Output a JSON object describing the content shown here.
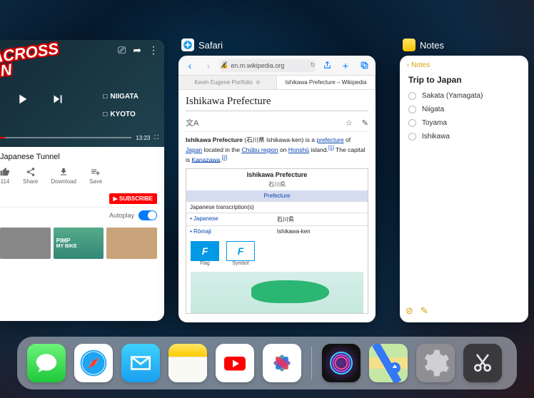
{
  "switcher": {
    "apps": [
      {
        "name": "Safari",
        "icon": "safari"
      },
      {
        "name": "Notes",
        "icon": "notes"
      }
    ]
  },
  "youtube": {
    "overlay_title_line1": "Y ACROSS",
    "overlay_title_line2": "PAN",
    "map_labels": [
      "NIIGATA",
      "KYOTO"
    ],
    "duration": "13:23",
    "video_title": "Japanese Tunnel",
    "actions": {
      "likes": "114",
      "share": "Share",
      "download": "Download",
      "save": "Save"
    },
    "subscribe": "SUBSCRIBE",
    "autoplay_label": "Autoplay",
    "thumbs": [
      {
        "l1": "",
        "l2": ""
      },
      {
        "l1": "PIMP",
        "l2": "MY BIKE"
      },
      {
        "l1": "",
        "l2": ""
      }
    ]
  },
  "safari": {
    "url": "en.m.wikipedia.org",
    "tabs": [
      "Kevin Eugene Portfolio",
      "Ishikawa Prefecture – Wikipedia"
    ],
    "article": {
      "title": "Ishikawa Prefecture",
      "lead_pre": "Ishikawa Prefecture (石川県 Ishikawa-ken) is a ",
      "link1": "prefecture",
      "mid1": " of ",
      "link2": "Japan",
      "mid2": " located in the ",
      "link3": "Chūbu region",
      "mid3": " on ",
      "link4": "Honshū",
      "mid4": " island.",
      "ref1": "[1]",
      "cap_pre": " The capital is ",
      "link5": "Kanazawa",
      "post": ".",
      "ref2": "[2]"
    },
    "infobox": {
      "title": "Ishikawa Prefecture",
      "native": "石川県",
      "section": "Prefecture",
      "trans_header": "Japanese transcription(s)",
      "rows": [
        {
          "k": "• Japanese",
          "v": "石川県"
        },
        {
          "k": "• Rōmaji",
          "v": "Ishikawa-ken"
        }
      ],
      "flag_label": "Flag",
      "symbol_label": "Symbol"
    }
  },
  "notes": {
    "back": "Notes",
    "title": "Trip to Japan",
    "items": [
      "Sakata (Yamagata)",
      "Niigata",
      "Toyama",
      "Ishikawa"
    ]
  },
  "dock": {
    "apps_left": [
      "Messages",
      "Safari",
      "Mail",
      "Notes",
      "YouTube",
      "Photos"
    ],
    "apps_right": [
      "Siri",
      "Maps",
      "Settings",
      "Shortcuts"
    ]
  }
}
